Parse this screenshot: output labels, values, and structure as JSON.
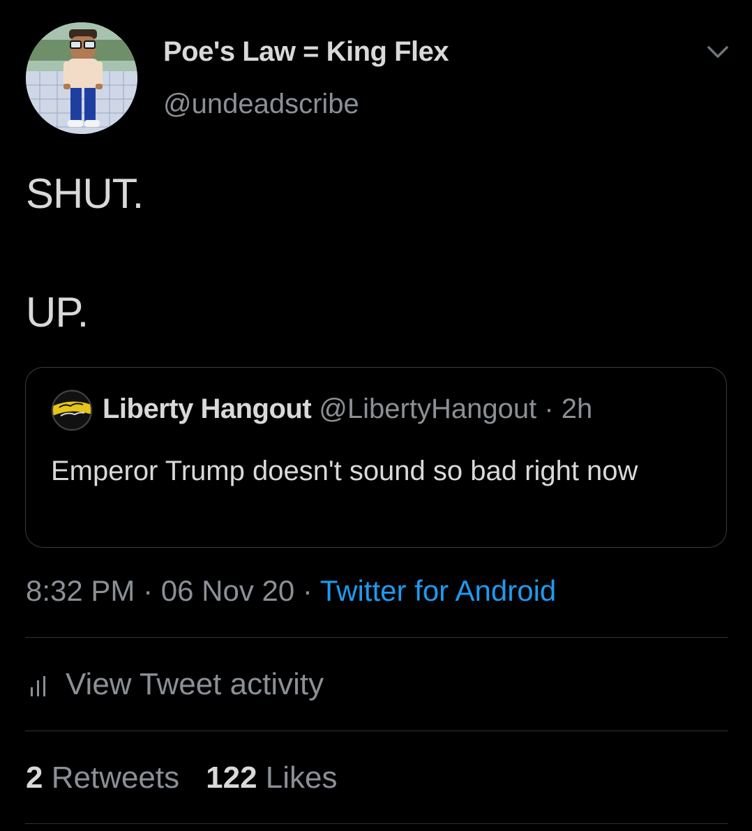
{
  "author": {
    "display_name": "Poe's Law = King Flex",
    "handle": "@undeadscribe",
    "avatar": "cartoon-character-avatar"
  },
  "tweet": {
    "line1": "SHUT.",
    "line2": "UP."
  },
  "quoted_tweet": {
    "name": "Liberty Hangout",
    "handle": "@LibertyHangout",
    "separator": " · ",
    "time": "2h",
    "text": "Emperor Trump doesn't sound so bad right now",
    "avatar_logo_text": "Liberty Hangout"
  },
  "meta": {
    "time": "8:32 PM",
    "date": "06 Nov 20",
    "source": "Twitter for Android",
    "separator": " · "
  },
  "activity": {
    "label": "View Tweet activity",
    "icon": "bar-chart-icon"
  },
  "stats": {
    "retweets_count": "2",
    "retweets_label": "Retweets",
    "likes_count": "122",
    "likes_label": "Likes"
  },
  "colors": {
    "background": "#000000",
    "text": "#d9d9d9",
    "secondary": "#8b9096",
    "link": "#1d9bf0",
    "border": "#2f3336"
  }
}
